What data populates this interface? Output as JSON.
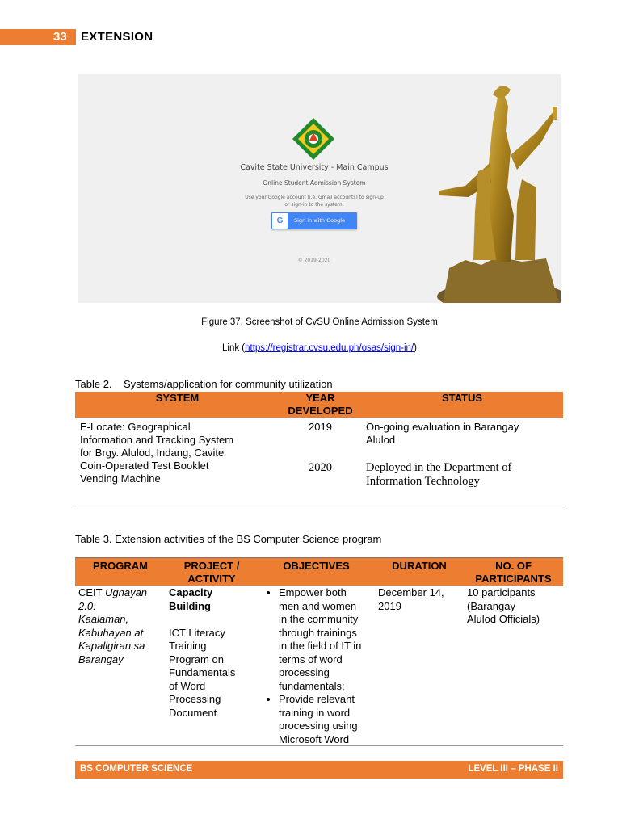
{
  "header": {
    "page_number": "33",
    "title": "EXTENSION"
  },
  "figure": {
    "screen": {
      "institution": "Cavite State University - Main Campus",
      "system_name": "Online Student Admission System",
      "instruction_line1": "Use your Google account (i.e. Gmail accounts) to sign-up",
      "instruction_line2": "or sign-in to the system.",
      "google_button_label": "Sign in with Google",
      "copyright": "© 2019-2020"
    },
    "caption": "Figure 37. Screenshot of CvSU Online Admission System",
    "link_prefix": "Link (",
    "link_url": "https://registrar.cvsu.edu.ph/osas/sign-in/",
    "link_suffix": ")"
  },
  "table2": {
    "caption_label": "Table 2.",
    "caption_text": "Systems/application for community utilization",
    "headers": {
      "system": "SYSTEM",
      "year_line1": "YEAR",
      "year_line2": "DEVELOPED",
      "status": "STATUS"
    },
    "rows": [
      {
        "system_lines": [
          "E-Locate: Geographical",
          "Information and Tracking System",
          "for Brgy. Alulod, Indang, Cavite"
        ],
        "year": "2019",
        "status_lines": [
          "On-going evaluation in Barangay",
          "Alulod"
        ]
      },
      {
        "system_lines": [
          "Coin-Operated Test Booklet",
          "Vending Machine"
        ],
        "year": "2020",
        "status_lines": [
          "Deployed in the Department of",
          "Information Technology"
        ]
      }
    ]
  },
  "table3": {
    "caption": "Table 3. Extension activities of the BS Computer Science program",
    "headers": {
      "program": "PROGRAM",
      "project_line1": "PROJECT /",
      "project_line2": "ACTIVITY",
      "objectives": "OBJECTIVES",
      "duration": "DURATION",
      "participants_line1": "NO. OF",
      "participants_line2": "PARTICIPANTS"
    },
    "row": {
      "program_line1_plain": "CEIT ",
      "program_line1_italic": "Ugnayan",
      "program_lines_italic": [
        "2.0:",
        "Kaalaman,",
        "Kabuhayan at",
        "Kapaligiran sa",
        "Barangay"
      ],
      "project_bold_lines": [
        "Capacity",
        "Building"
      ],
      "project_lines": [
        "ICT Literacy",
        "Training",
        "Program on",
        "Fundamentals",
        "of Word",
        "Processing",
        "Document"
      ],
      "objective1_lines": [
        "Empower both",
        "men and women",
        "in the community",
        "through trainings",
        "in the field of IT in",
        "terms of word",
        "processing",
        "fundamentals;"
      ],
      "objective2_lines": [
        "Provide relevant",
        "training in word",
        "processing using",
        "Microsoft Word"
      ],
      "duration_lines": [
        "December 14,",
        "2019"
      ],
      "participants_lines": [
        "10 participants",
        "(Barangay",
        "Alulod Officials)"
      ]
    }
  },
  "footer": {
    "left": "BS COMPUTER SCIENCE",
    "right": "LEVEL III – PHASE II"
  },
  "colors": {
    "accent": "#ed7d31",
    "link": "#0000ee"
  },
  "icons": [
    "cvsu-seal-icon",
    "google-g-icon",
    "statue-image"
  ]
}
